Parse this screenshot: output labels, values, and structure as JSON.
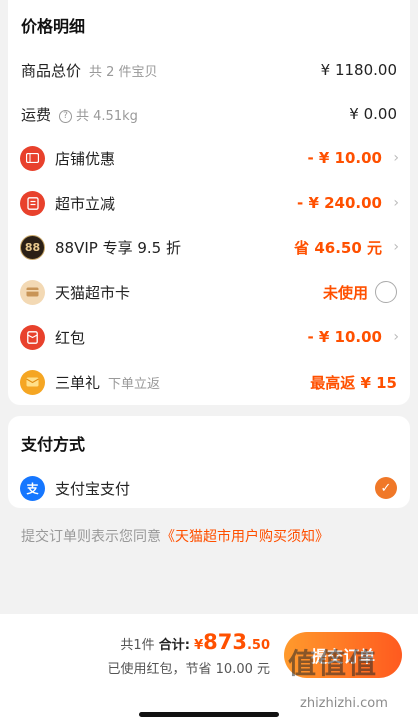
{
  "price_detail": {
    "title": "价格明细",
    "rows": [
      {
        "label": "商品总价",
        "sub": "共 2 件宝贝",
        "value": "¥ 1180.00"
      },
      {
        "label": "运费",
        "sub": "共 4.51kg",
        "value": "¥ 0.00"
      },
      {
        "label": "店铺优惠",
        "value": "- ¥ 10.00",
        "icon": "ticket-icon"
      },
      {
        "label": "超市立减",
        "value": "- ¥ 240.00",
        "icon": "discount-icon"
      },
      {
        "label": "88VIP 专享 9.5 折",
        "value": "省 46.50 元",
        "icon": "88vip-icon",
        "icon_text": "88"
      },
      {
        "label": "天猫超市卡",
        "value": "未使用",
        "icon": "card-icon"
      },
      {
        "label": "红包",
        "value": "- ¥ 10.00",
        "icon": "red-envelope-icon"
      },
      {
        "label": "三单礼",
        "sub": "下单立返",
        "value": "最高返 ¥ 15",
        "icon": "gift-icon"
      }
    ]
  },
  "payment": {
    "title": "支付方式",
    "method": "支付宝支付",
    "icon_text": "支"
  },
  "notice": {
    "prefix": "提交订单则表示您同意",
    "link": "《天猫超市用户购买须知》"
  },
  "bottom": {
    "count": "共1件",
    "total_label": "合计:",
    "currency": "¥",
    "total_int": "873",
    "total_dec": ".50",
    "saving": "已使用红包，节省 10.00 元",
    "submit_label": "提交订单"
  },
  "watermark": {
    "text": "值值值",
    "url": "zhizhizhi.com"
  },
  "colors": {
    "accent": "#ff5000",
    "ticket": "#e8412c",
    "discount": "#e8412c",
    "vip": "#2b2016",
    "card": "#f3d9b4",
    "envelope": "#e8412c",
    "gift": "#f5a623",
    "alipay": "#1677ff"
  }
}
